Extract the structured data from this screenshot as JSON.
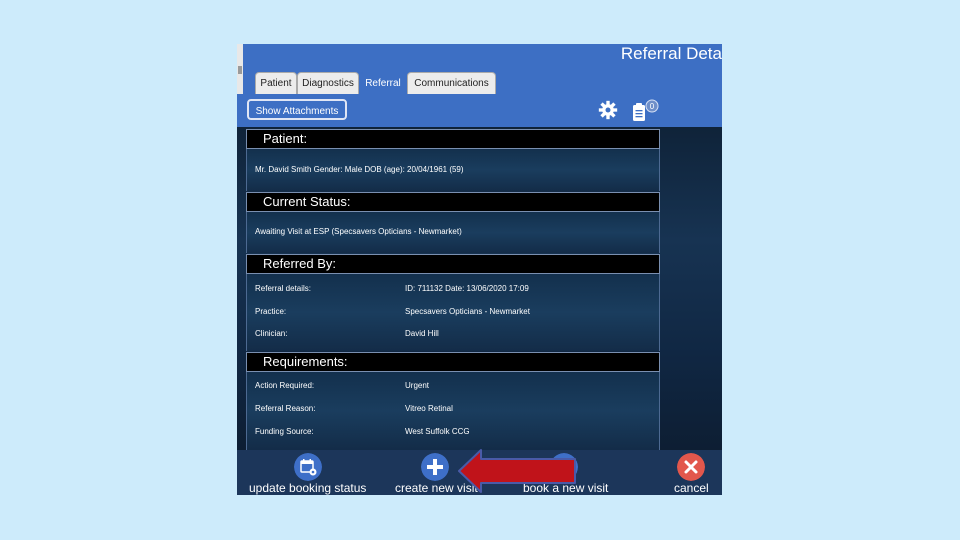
{
  "window": {
    "title": "Referral Deta"
  },
  "tabs": [
    {
      "label": "Patient"
    },
    {
      "label": "Diagnostics"
    },
    {
      "label": "Referral"
    },
    {
      "label": "Communications"
    }
  ],
  "toolbar": {
    "show_attachments": "Show Attachments",
    "attachment_count": "0"
  },
  "patient": {
    "heading": "Patient:",
    "info": "Mr. David Smith   Gender: Male   DOB (age): 20/04/1961 (59)"
  },
  "status": {
    "heading": "Current Status:",
    "text": "Awaiting Visit at ESP (Specsavers Opticians - Newmarket)"
  },
  "referred_by": {
    "heading": "Referred By:",
    "rows": [
      {
        "label": "Referral details:",
        "value": "ID: 711132  Date: 13/06/2020 17:09"
      },
      {
        "label": "Practice:",
        "value": "Specsavers Opticians - Newmarket"
      },
      {
        "label": "Clinician:",
        "value": "David Hill"
      }
    ]
  },
  "requirements": {
    "heading": "Requirements:",
    "rows": [
      {
        "label": "Action Required:",
        "value": "Urgent"
      },
      {
        "label": "Referral Reason:",
        "value": "Vitreo Retinal"
      },
      {
        "label": "Funding Source:",
        "value": "West Suffolk CCG"
      }
    ]
  },
  "actions": {
    "update_booking": "update booking status",
    "create_visit": "create new visit",
    "book_visit": "book a new visit",
    "cancel": "cancel"
  },
  "colors": {
    "app_blue": "#3d6fc4",
    "content_dark": "#102743",
    "bottom_bar": "#1c365a",
    "action_blue": "#3e6fc8",
    "cancel_red": "#e2574c",
    "arrow_red": "#c0131a"
  }
}
